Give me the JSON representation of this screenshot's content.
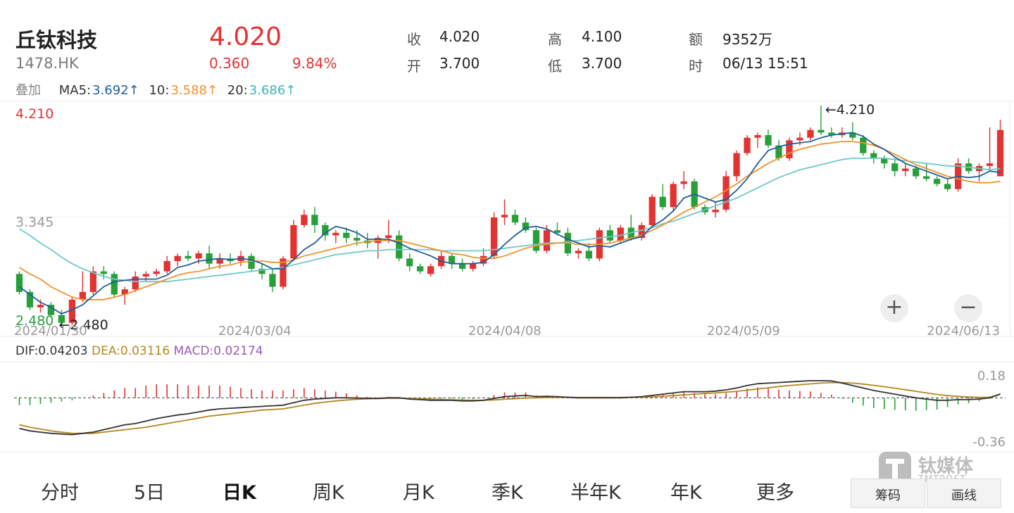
{
  "header": {
    "name": "丘钛科技",
    "code": "1478.HK",
    "price": "4.020",
    "change": "0.360",
    "change_pct": "9.84%",
    "stats": [
      {
        "label": "收",
        "value": "4.020"
      },
      {
        "label": "高",
        "value": "4.100"
      },
      {
        "label": "额",
        "value": "9352万"
      },
      {
        "label": "开",
        "value": "3.700"
      },
      {
        "label": "低",
        "value": "3.700"
      },
      {
        "label": "时",
        "value": "06/13 15:51"
      }
    ]
  },
  "ma_row": {
    "overlay_label": "叠加",
    "ma5_label": "MA5:",
    "ma5_value": "3.692↑",
    "ma10_label": "10:",
    "ma10_value": "3.588↑",
    "ma20_label": "20:",
    "ma20_value": "3.686↑"
  },
  "colors": {
    "up": "#e23333",
    "down": "#27a03a",
    "ma5": "#1f5f99",
    "ma10": "#f0922f",
    "ma20": "#70c8c8",
    "dif": "#333333",
    "dea": "#b8861f",
    "macd": "#9b59b6"
  },
  "macd_header": {
    "dif": "DIF:0.04203",
    "dea": "DEA:0.03116",
    "macd": "MACD:0.02174"
  },
  "chart_data": [
    {
      "type": "candlestick",
      "y_axis_labels": [
        "4.210",
        "3.345",
        "2.480"
      ],
      "ylim": [
        2.48,
        4.21
      ],
      "x_tick_labels": [
        "2024/01/30",
        "2024/03/04",
        "2024/04/08",
        "2024/05/09",
        "2024/06/13"
      ],
      "annotations": [
        {
          "text": "4.210",
          "type": "max"
        },
        {
          "text": "2.480",
          "type": "min"
        }
      ],
      "candles": [
        [
          2.9,
          2.92,
          2.74,
          2.76
        ],
        [
          2.76,
          2.78,
          2.62,
          2.64
        ],
        [
          2.64,
          2.7,
          2.6,
          2.66
        ],
        [
          2.66,
          2.68,
          2.56,
          2.58
        ],
        [
          2.58,
          2.62,
          2.48,
          2.52
        ],
        [
          2.52,
          2.72,
          2.5,
          2.7
        ],
        [
          2.7,
          2.92,
          2.68,
          2.76
        ],
        [
          2.76,
          2.96,
          2.74,
          2.92
        ],
        [
          2.92,
          2.96,
          2.86,
          2.9
        ],
        [
          2.9,
          2.92,
          2.72,
          2.74
        ],
        [
          2.74,
          2.8,
          2.66,
          2.78
        ],
        [
          2.78,
          2.92,
          2.76,
          2.88
        ],
        [
          2.88,
          2.92,
          2.84,
          2.9
        ],
        [
          2.9,
          2.94,
          2.88,
          2.92
        ],
        [
          2.92,
          3.04,
          2.9,
          3.0
        ],
        [
          3.0,
          3.06,
          2.96,
          3.04
        ],
        [
          3.04,
          3.08,
          3.0,
          3.02
        ],
        [
          3.02,
          3.08,
          2.98,
          3.06
        ],
        [
          3.06,
          3.12,
          2.94,
          2.98
        ],
        [
          2.98,
          3.06,
          2.94,
          3.02
        ],
        [
          3.02,
          3.06,
          2.98,
          3.0
        ],
        [
          3.0,
          3.08,
          2.96,
          3.04
        ],
        [
          3.04,
          3.06,
          2.92,
          2.94
        ],
        [
          2.94,
          2.98,
          2.86,
          2.9
        ],
        [
          2.9,
          2.94,
          2.76,
          2.8
        ],
        [
          2.8,
          3.04,
          2.78,
          3.02
        ],
        [
          3.02,
          3.32,
          3.0,
          3.28
        ],
        [
          3.28,
          3.4,
          3.26,
          3.36
        ],
        [
          3.36,
          3.42,
          3.22,
          3.28
        ],
        [
          3.28,
          3.3,
          3.16,
          3.2
        ],
        [
          3.2,
          3.24,
          3.14,
          3.22
        ],
        [
          3.22,
          3.26,
          3.14,
          3.18
        ],
        [
          3.18,
          3.24,
          3.12,
          3.16
        ],
        [
          3.16,
          3.22,
          3.1,
          3.14
        ],
        [
          3.14,
          3.2,
          3.02,
          3.18
        ],
        [
          3.18,
          3.32,
          3.14,
          3.2
        ],
        [
          3.2,
          3.24,
          3.0,
          3.02
        ],
        [
          3.02,
          3.06,
          2.92,
          2.96
        ],
        [
          2.96,
          2.98,
          2.9,
          2.92
        ],
        [
          2.9,
          2.98,
          2.88,
          2.96
        ],
        [
          2.96,
          3.08,
          2.94,
          3.04
        ],
        [
          3.04,
          3.06,
          2.94,
          2.98
        ],
        [
          2.98,
          3.02,
          2.92,
          2.94
        ],
        [
          2.94,
          3.0,
          2.92,
          2.98
        ],
        [
          2.98,
          3.1,
          2.96,
          3.04
        ],
        [
          3.04,
          3.38,
          3.02,
          3.34
        ],
        [
          3.34,
          3.48,
          3.28,
          3.36
        ],
        [
          3.36,
          3.4,
          3.28,
          3.3
        ],
        [
          3.3,
          3.34,
          3.22,
          3.24
        ],
        [
          3.24,
          3.26,
          3.06,
          3.08
        ],
        [
          3.08,
          3.28,
          3.06,
          3.24
        ],
        [
          3.24,
          3.3,
          3.2,
          3.22
        ],
        [
          3.22,
          3.26,
          3.04,
          3.06
        ],
        [
          3.06,
          3.1,
          3.02,
          3.08
        ],
        [
          3.08,
          3.14,
          3.0,
          3.02
        ],
        [
          3.02,
          3.26,
          3.0,
          3.24
        ],
        [
          3.24,
          3.28,
          3.14,
          3.16
        ],
        [
          3.16,
          3.28,
          3.14,
          3.26
        ],
        [
          3.26,
          3.36,
          3.16,
          3.18
        ],
        [
          3.18,
          3.3,
          3.16,
          3.28
        ],
        [
          3.28,
          3.52,
          3.26,
          3.5
        ],
        [
          3.5,
          3.6,
          3.4,
          3.42
        ],
        [
          3.42,
          3.62,
          3.38,
          3.6
        ],
        [
          3.6,
          3.7,
          3.56,
          3.62
        ],
        [
          3.62,
          3.64,
          3.4,
          3.42
        ],
        [
          3.42,
          3.44,
          3.36,
          3.38
        ],
        [
          3.38,
          3.46,
          3.34,
          3.4
        ],
        [
          3.4,
          3.7,
          3.38,
          3.66
        ],
        [
          3.66,
          3.86,
          3.62,
          3.84
        ],
        [
          3.84,
          3.98,
          3.82,
          3.96
        ],
        [
          3.96,
          4.0,
          3.88,
          3.98
        ],
        [
          3.98,
          4.02,
          3.88,
          3.9
        ],
        [
          3.9,
          3.94,
          3.78,
          3.8
        ],
        [
          3.8,
          3.96,
          3.78,
          3.94
        ],
        [
          3.94,
          4.0,
          3.9,
          3.96
        ],
        [
          3.96,
          4.04,
          3.94,
          4.02
        ],
        [
          4.02,
          4.21,
          3.98,
          4.0
        ],
        [
          4.0,
          4.04,
          3.96,
          3.98
        ],
        [
          3.98,
          4.04,
          3.96,
          4.0
        ],
        [
          4.0,
          4.08,
          3.94,
          3.96
        ],
        [
          3.96,
          3.98,
          3.82,
          3.84
        ],
        [
          3.84,
          3.86,
          3.76,
          3.8
        ],
        [
          3.8,
          3.82,
          3.72,
          3.76
        ],
        [
          3.76,
          3.8,
          3.66,
          3.7
        ],
        [
          3.7,
          3.76,
          3.66,
          3.72
        ],
        [
          3.72,
          3.74,
          3.64,
          3.66
        ],
        [
          3.66,
          3.76,
          3.62,
          3.64
        ],
        [
          3.64,
          3.66,
          3.58,
          3.6
        ],
        [
          3.6,
          3.64,
          3.54,
          3.56
        ],
        [
          3.56,
          3.8,
          3.54,
          3.76
        ],
        [
          3.76,
          3.8,
          3.68,
          3.7
        ],
        [
          3.7,
          3.76,
          3.62,
          3.74
        ],
        [
          3.74,
          4.04,
          3.7,
          3.76
        ],
        [
          3.66,
          4.1,
          3.66,
          4.02
        ]
      ],
      "ma5": [
        2.8,
        2.74,
        2.68,
        2.64,
        2.59,
        2.62,
        2.66,
        2.73,
        2.8,
        2.84,
        2.85,
        2.86,
        2.86,
        2.86,
        2.89,
        2.95,
        2.97,
        3.0,
        3.01,
        3.02,
        3.01,
        3.02,
        3.01,
        2.98,
        2.94,
        2.94,
        3.01,
        3.09,
        3.14,
        3.22,
        3.27,
        3.25,
        3.22,
        3.17,
        3.17,
        3.17,
        3.14,
        3.1,
        3.07,
        3.04,
        3.0,
        2.98,
        2.98,
        2.98,
        2.99,
        3.05,
        3.13,
        3.2,
        3.26,
        3.27,
        3.25,
        3.21,
        3.17,
        3.14,
        3.11,
        3.12,
        3.11,
        3.14,
        3.17,
        3.19,
        3.27,
        3.32,
        3.39,
        3.49,
        3.52,
        3.49,
        3.46,
        3.48,
        3.55,
        3.64,
        3.76,
        3.86,
        3.89,
        3.91,
        3.92,
        3.93,
        3.96,
        3.98,
        3.99,
        4.0,
        3.97,
        3.91,
        3.87,
        3.81,
        3.76,
        3.73,
        3.7,
        3.67,
        3.64,
        3.66,
        3.65,
        3.66,
        3.7,
        3.69
      ],
      "ma10": [
        2.95,
        2.9,
        2.86,
        2.8,
        2.76,
        2.72,
        2.7,
        2.7,
        2.7,
        2.72,
        2.74,
        2.77,
        2.8,
        2.83,
        2.86,
        2.89,
        2.91,
        2.92,
        2.94,
        2.96,
        2.97,
        2.99,
        3.0,
        3.0,
        2.99,
        2.99,
        3.01,
        3.04,
        3.06,
        3.08,
        3.1,
        3.12,
        3.14,
        3.15,
        3.16,
        3.16,
        3.16,
        3.14,
        3.12,
        3.1,
        3.08,
        3.06,
        3.05,
        3.03,
        3.02,
        3.02,
        3.04,
        3.07,
        3.1,
        3.12,
        3.13,
        3.14,
        3.14,
        3.13,
        3.13,
        3.13,
        3.14,
        3.16,
        3.18,
        3.2,
        3.24,
        3.28,
        3.33,
        3.38,
        3.42,
        3.46,
        3.5,
        3.55,
        3.6,
        3.66,
        3.71,
        3.76,
        3.8,
        3.84,
        3.87,
        3.89,
        3.91,
        3.92,
        3.93,
        3.93,
        3.92,
        3.9,
        3.87,
        3.83,
        3.79,
        3.75,
        3.72,
        3.69,
        3.66,
        3.64,
        3.62,
        3.61,
        3.61,
        3.62
      ],
      "ma20": [
        3.25,
        3.2,
        3.14,
        3.09,
        3.03,
        2.98,
        2.94,
        2.91,
        2.88,
        2.86,
        2.85,
        2.84,
        2.84,
        2.84,
        2.84,
        2.85,
        2.86,
        2.87,
        2.88,
        2.89,
        2.9,
        2.91,
        2.92,
        2.93,
        2.94,
        2.95,
        2.97,
        2.99,
        3.01,
        3.03,
        3.05,
        3.06,
        3.07,
        3.08,
        3.08,
        3.09,
        3.09,
        3.09,
        3.09,
        3.09,
        3.08,
        3.08,
        3.08,
        3.08,
        3.08,
        3.09,
        3.1,
        3.11,
        3.12,
        3.13,
        3.14,
        3.14,
        3.15,
        3.16,
        3.17,
        3.18,
        3.19,
        3.2,
        3.22,
        3.24,
        3.26,
        3.29,
        3.31,
        3.34,
        3.37,
        3.4,
        3.43,
        3.46,
        3.49,
        3.53,
        3.57,
        3.61,
        3.65,
        3.68,
        3.71,
        3.73,
        3.75,
        3.77,
        3.79,
        3.8,
        3.8,
        3.8,
        3.8,
        3.79,
        3.78,
        3.77,
        3.76,
        3.75,
        3.74,
        3.74,
        3.73,
        3.72,
        3.71,
        3.72
      ]
    },
    {
      "type": "macd",
      "y_axis_labels": [
        "0.18",
        "-0.36"
      ],
      "ylim": [
        -0.36,
        0.18
      ],
      "dif": [
        -0.25,
        -0.27,
        -0.28,
        -0.29,
        -0.295,
        -0.3,
        -0.29,
        -0.28,
        -0.26,
        -0.24,
        -0.22,
        -0.21,
        -0.19,
        -0.17,
        -0.155,
        -0.14,
        -0.13,
        -0.115,
        -0.1,
        -0.09,
        -0.085,
        -0.08,
        -0.075,
        -0.07,
        -0.065,
        -0.06,
        -0.04,
        -0.02,
        -0.01,
        -0.005,
        0.0,
        0.0,
        -0.002,
        -0.004,
        -0.005,
        0.0,
        0.0,
        -0.01,
        -0.015,
        -0.02,
        -0.02,
        -0.02,
        -0.025,
        -0.025,
        -0.02,
        -0.005,
        0.01,
        0.015,
        0.02,
        0.01,
        0.012,
        0.01,
        0.005,
        0.0,
        0.0,
        0.0,
        0.0,
        0.0,
        0.005,
        0.01,
        0.02,
        0.03,
        0.04,
        0.05,
        0.05,
        0.05,
        0.055,
        0.065,
        0.08,
        0.1,
        0.115,
        0.12,
        0.125,
        0.13,
        0.135,
        0.14,
        0.14,
        0.138,
        0.12,
        0.1,
        0.08,
        0.06,
        0.045,
        0.03,
        0.015,
        0.0,
        -0.01,
        -0.02,
        -0.02,
        -0.015,
        -0.015,
        -0.01,
        0.0,
        0.03
      ],
      "dea": [
        -0.22,
        -0.24,
        -0.255,
        -0.27,
        -0.28,
        -0.29,
        -0.29,
        -0.29,
        -0.28,
        -0.27,
        -0.26,
        -0.25,
        -0.24,
        -0.225,
        -0.21,
        -0.195,
        -0.18,
        -0.165,
        -0.15,
        -0.14,
        -0.13,
        -0.12,
        -0.11,
        -0.1,
        -0.095,
        -0.09,
        -0.075,
        -0.06,
        -0.045,
        -0.035,
        -0.025,
        -0.018,
        -0.012,
        -0.008,
        -0.006,
        -0.004,
        -0.003,
        -0.005,
        -0.008,
        -0.011,
        -0.014,
        -0.016,
        -0.018,
        -0.02,
        -0.02,
        -0.017,
        -0.012,
        -0.007,
        -0.002,
        0.0,
        0.003,
        0.004,
        0.004,
        0.003,
        0.003,
        0.003,
        0.003,
        0.003,
        0.004,
        0.006,
        0.009,
        0.013,
        0.018,
        0.024,
        0.03,
        0.035,
        0.04,
        0.046,
        0.053,
        0.062,
        0.072,
        0.082,
        0.092,
        0.1,
        0.107,
        0.114,
        0.12,
        0.125,
        0.124,
        0.12,
        0.112,
        0.102,
        0.091,
        0.079,
        0.066,
        0.053,
        0.04,
        0.028,
        0.018,
        0.012,
        0.007,
        0.004,
        0.004,
        0.031
      ]
    }
  ],
  "tabs": [
    "分时",
    "5日",
    "日K",
    "周K",
    "月K",
    "季K",
    "半年K",
    "年K",
    "更多"
  ],
  "active_tab": "日K",
  "bottom_right": {
    "chips": "筹码",
    "draw": "画线"
  },
  "zoom": {
    "in": "+",
    "out": "−"
  },
  "watermark": {
    "cn": "钛媒体",
    "en": "TMTPOST"
  }
}
